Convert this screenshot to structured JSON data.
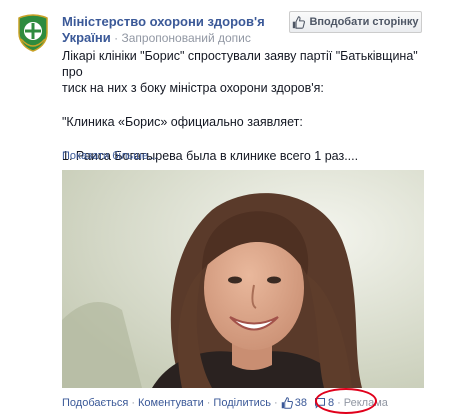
{
  "post": {
    "page_name_line1": "Міністерство охорони здоров'я",
    "page_name_line2": "України",
    "sponsored_label": "Запропонований допис",
    "like_page_button": "Вподобати сторінку",
    "text_line1": "Лікарі клініки \"Борис\" спростували заяву партії \"Батьківщина\" про",
    "text_line2": "тиск на них з боку міністра охорони здоров'я:",
    "text_line3": "\"Клиника «Борис» официально заявляет:",
    "text_line4": "1. Раиса Богатырева была в клинике всего 1 раз....",
    "show_more": "Показати більше..."
  },
  "actions": {
    "like": "Подобається",
    "comment": "Коментувати",
    "share": "Поділитись",
    "like_count": "38",
    "comment_count": "8",
    "ad_label": "Реклама"
  },
  "colors": {
    "link_blue": "#3b5998",
    "muted_gray": "#9197a3",
    "annotation_red": "#e0001b",
    "emblem_green": "#2e8b3e"
  },
  "icons": {
    "avatar": "ministry-emblem-icon",
    "like_button": "thumbs-up-icon",
    "comments": "comment-bubble-icon"
  }
}
